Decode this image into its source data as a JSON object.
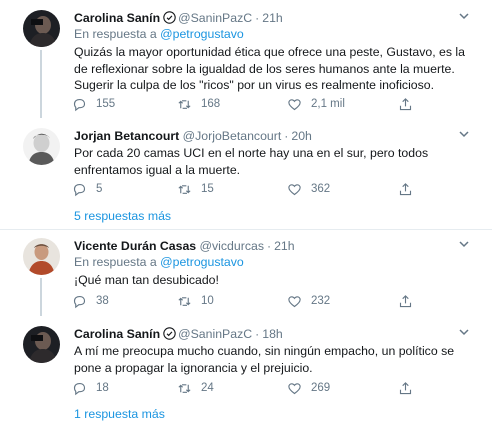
{
  "tweets": [
    {
      "author": "Carolina Sanín",
      "handle": "@SaninPazC",
      "time": "21h",
      "verified": true,
      "reply_prefix": "En respuesta a",
      "reply_mention": "@petrogustavo",
      "text": "Quizás la mayor oportunidad ética que ofrece una peste, Gustavo, es la de reflexionar sobre la igualdad de los seres humanos ante la muerte. Sugerir la culpa de los \"ricos\" por un virus es realmente inoficioso.",
      "replies": "155",
      "retweets": "168",
      "likes": "2,1 mil"
    },
    {
      "author": "Jorjan Betancourt",
      "handle": "@JorjoBetancourt",
      "time": "20h",
      "verified": false,
      "text": "Por cada 20 camas UCI en el norte hay una en el sur, pero todos enfrentamos igual a la muerte.",
      "replies": "5",
      "retweets": "15",
      "likes": "362",
      "more_replies": "5 respuestas más"
    },
    {
      "author": "Vicente Durán Casas",
      "handle": "@vicdurcas",
      "time": "21h",
      "verified": false,
      "reply_prefix": "En respuesta a",
      "reply_mention": "@petrogustavo",
      "text": "¡Qué man tan desubicado!",
      "replies": "38",
      "retweets": "10",
      "likes": "232"
    },
    {
      "author": "Carolina Sanín",
      "handle": "@SaninPazC",
      "time": "18h",
      "verified": true,
      "text": "A mí me preocupa mucho cuando, sin ningún empacho, un político se pone a propagar la ignorancia y el prejuicio.",
      "replies": "18",
      "retweets": "24",
      "likes": "269",
      "more_replies": "1 respuesta más"
    }
  ],
  "separator_dot": "·",
  "colors": {
    "text": "#14171a",
    "secondary": "#657786",
    "link": "#1b95e0",
    "verified": "#1da1f2",
    "border": "#e6ecf0"
  },
  "icons": [
    "reply-icon",
    "retweet-icon",
    "like-icon",
    "share-icon",
    "verified-icon",
    "chevron-down-icon"
  ]
}
